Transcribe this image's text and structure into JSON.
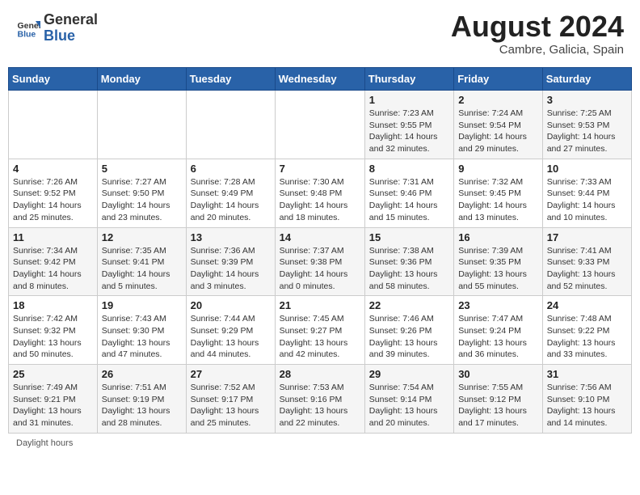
{
  "header": {
    "logo_line1": "General",
    "logo_line2": "Blue",
    "month": "August 2024",
    "location": "Cambre, Galicia, Spain"
  },
  "days_of_week": [
    "Sunday",
    "Monday",
    "Tuesday",
    "Wednesday",
    "Thursday",
    "Friday",
    "Saturday"
  ],
  "weeks": [
    [
      {
        "day": "",
        "info": ""
      },
      {
        "day": "",
        "info": ""
      },
      {
        "day": "",
        "info": ""
      },
      {
        "day": "",
        "info": ""
      },
      {
        "day": "1",
        "info": "Sunrise: 7:23 AM\nSunset: 9:55 PM\nDaylight: 14 hours\nand 32 minutes."
      },
      {
        "day": "2",
        "info": "Sunrise: 7:24 AM\nSunset: 9:54 PM\nDaylight: 14 hours\nand 29 minutes."
      },
      {
        "day": "3",
        "info": "Sunrise: 7:25 AM\nSunset: 9:53 PM\nDaylight: 14 hours\nand 27 minutes."
      }
    ],
    [
      {
        "day": "4",
        "info": "Sunrise: 7:26 AM\nSunset: 9:52 PM\nDaylight: 14 hours\nand 25 minutes."
      },
      {
        "day": "5",
        "info": "Sunrise: 7:27 AM\nSunset: 9:50 PM\nDaylight: 14 hours\nand 23 minutes."
      },
      {
        "day": "6",
        "info": "Sunrise: 7:28 AM\nSunset: 9:49 PM\nDaylight: 14 hours\nand 20 minutes."
      },
      {
        "day": "7",
        "info": "Sunrise: 7:30 AM\nSunset: 9:48 PM\nDaylight: 14 hours\nand 18 minutes."
      },
      {
        "day": "8",
        "info": "Sunrise: 7:31 AM\nSunset: 9:46 PM\nDaylight: 14 hours\nand 15 minutes."
      },
      {
        "day": "9",
        "info": "Sunrise: 7:32 AM\nSunset: 9:45 PM\nDaylight: 14 hours\nand 13 minutes."
      },
      {
        "day": "10",
        "info": "Sunrise: 7:33 AM\nSunset: 9:44 PM\nDaylight: 14 hours\nand 10 minutes."
      }
    ],
    [
      {
        "day": "11",
        "info": "Sunrise: 7:34 AM\nSunset: 9:42 PM\nDaylight: 14 hours\nand 8 minutes."
      },
      {
        "day": "12",
        "info": "Sunrise: 7:35 AM\nSunset: 9:41 PM\nDaylight: 14 hours\nand 5 minutes."
      },
      {
        "day": "13",
        "info": "Sunrise: 7:36 AM\nSunset: 9:39 PM\nDaylight: 14 hours\nand 3 minutes."
      },
      {
        "day": "14",
        "info": "Sunrise: 7:37 AM\nSunset: 9:38 PM\nDaylight: 14 hours\nand 0 minutes."
      },
      {
        "day": "15",
        "info": "Sunrise: 7:38 AM\nSunset: 9:36 PM\nDaylight: 13 hours\nand 58 minutes."
      },
      {
        "day": "16",
        "info": "Sunrise: 7:39 AM\nSunset: 9:35 PM\nDaylight: 13 hours\nand 55 minutes."
      },
      {
        "day": "17",
        "info": "Sunrise: 7:41 AM\nSunset: 9:33 PM\nDaylight: 13 hours\nand 52 minutes."
      }
    ],
    [
      {
        "day": "18",
        "info": "Sunrise: 7:42 AM\nSunset: 9:32 PM\nDaylight: 13 hours\nand 50 minutes."
      },
      {
        "day": "19",
        "info": "Sunrise: 7:43 AM\nSunset: 9:30 PM\nDaylight: 13 hours\nand 47 minutes."
      },
      {
        "day": "20",
        "info": "Sunrise: 7:44 AM\nSunset: 9:29 PM\nDaylight: 13 hours\nand 44 minutes."
      },
      {
        "day": "21",
        "info": "Sunrise: 7:45 AM\nSunset: 9:27 PM\nDaylight: 13 hours\nand 42 minutes."
      },
      {
        "day": "22",
        "info": "Sunrise: 7:46 AM\nSunset: 9:26 PM\nDaylight: 13 hours\nand 39 minutes."
      },
      {
        "day": "23",
        "info": "Sunrise: 7:47 AM\nSunset: 9:24 PM\nDaylight: 13 hours\nand 36 minutes."
      },
      {
        "day": "24",
        "info": "Sunrise: 7:48 AM\nSunset: 9:22 PM\nDaylight: 13 hours\nand 33 minutes."
      }
    ],
    [
      {
        "day": "25",
        "info": "Sunrise: 7:49 AM\nSunset: 9:21 PM\nDaylight: 13 hours\nand 31 minutes."
      },
      {
        "day": "26",
        "info": "Sunrise: 7:51 AM\nSunset: 9:19 PM\nDaylight: 13 hours\nand 28 minutes."
      },
      {
        "day": "27",
        "info": "Sunrise: 7:52 AM\nSunset: 9:17 PM\nDaylight: 13 hours\nand 25 minutes."
      },
      {
        "day": "28",
        "info": "Sunrise: 7:53 AM\nSunset: 9:16 PM\nDaylight: 13 hours\nand 22 minutes."
      },
      {
        "day": "29",
        "info": "Sunrise: 7:54 AM\nSunset: 9:14 PM\nDaylight: 13 hours\nand 20 minutes."
      },
      {
        "day": "30",
        "info": "Sunrise: 7:55 AM\nSunset: 9:12 PM\nDaylight: 13 hours\nand 17 minutes."
      },
      {
        "day": "31",
        "info": "Sunrise: 7:56 AM\nSunset: 9:10 PM\nDaylight: 13 hours\nand 14 minutes."
      }
    ]
  ],
  "footer": {
    "note": "Daylight hours"
  }
}
